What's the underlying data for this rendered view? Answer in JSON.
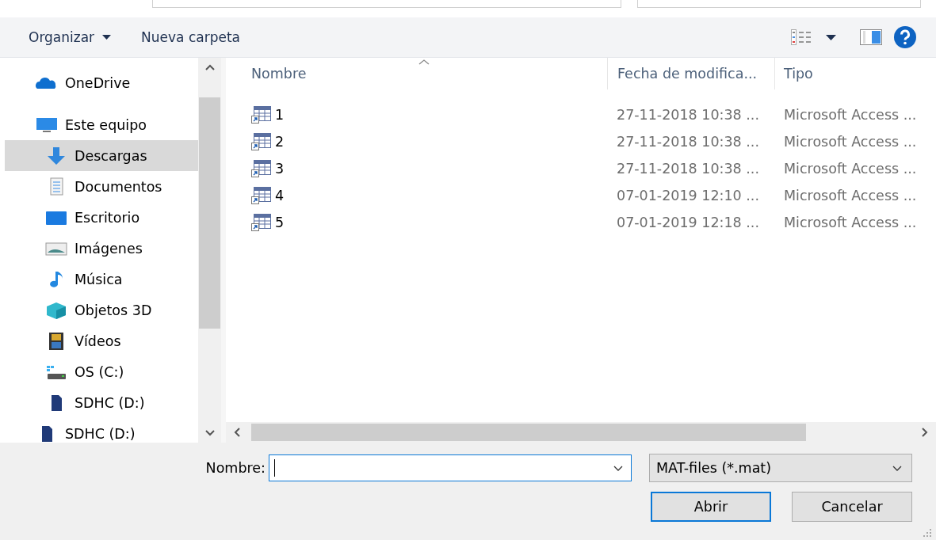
{
  "toolbar": {
    "organize": "Organizar",
    "new_folder": "Nueva carpeta"
  },
  "sidebar": {
    "items": [
      {
        "label": "OneDrive",
        "kind": "cloud",
        "selected": false
      },
      {
        "label": "Este equipo",
        "kind": "computer",
        "selected": false,
        "children": [
          {
            "label": "Descargas",
            "kind": "download",
            "selected": true
          },
          {
            "label": "Documentos",
            "kind": "document",
            "selected": false
          },
          {
            "label": "Escritorio",
            "kind": "desktop",
            "selected": false
          },
          {
            "label": "Imágenes",
            "kind": "image",
            "selected": false
          },
          {
            "label": "Música",
            "kind": "music",
            "selected": false
          },
          {
            "label": "Objetos 3D",
            "kind": "cube",
            "selected": false
          },
          {
            "label": "Vídeos",
            "kind": "film",
            "selected": false
          },
          {
            "label": "OS (C:)",
            "kind": "drive",
            "selected": false
          },
          {
            "label": "SDHC (D:)",
            "kind": "card",
            "selected": false
          }
        ]
      },
      {
        "label": "SDHC (D:)",
        "kind": "card",
        "selected": false
      }
    ]
  },
  "table": {
    "columns": [
      "Nombre",
      "Fecha de modifica...",
      "Tipo"
    ],
    "rows": [
      {
        "name": "1",
        "date": "27-11-2018 10:38 ...",
        "type": "Microsoft Access ..."
      },
      {
        "name": "2",
        "date": "27-11-2018 10:38 ...",
        "type": "Microsoft Access ..."
      },
      {
        "name": "3",
        "date": "27-11-2018 10:38 ...",
        "type": "Microsoft Access ..."
      },
      {
        "name": "4",
        "date": "07-01-2019 12:10 ...",
        "type": "Microsoft Access ..."
      },
      {
        "name": "5",
        "date": "07-01-2019 12:18 ...",
        "type": "Microsoft Access ..."
      }
    ]
  },
  "footer": {
    "filename_label": "Nombre:",
    "filter": "MAT-files (*.mat)",
    "buttons": [
      "Abrir",
      "Cancelar"
    ]
  }
}
